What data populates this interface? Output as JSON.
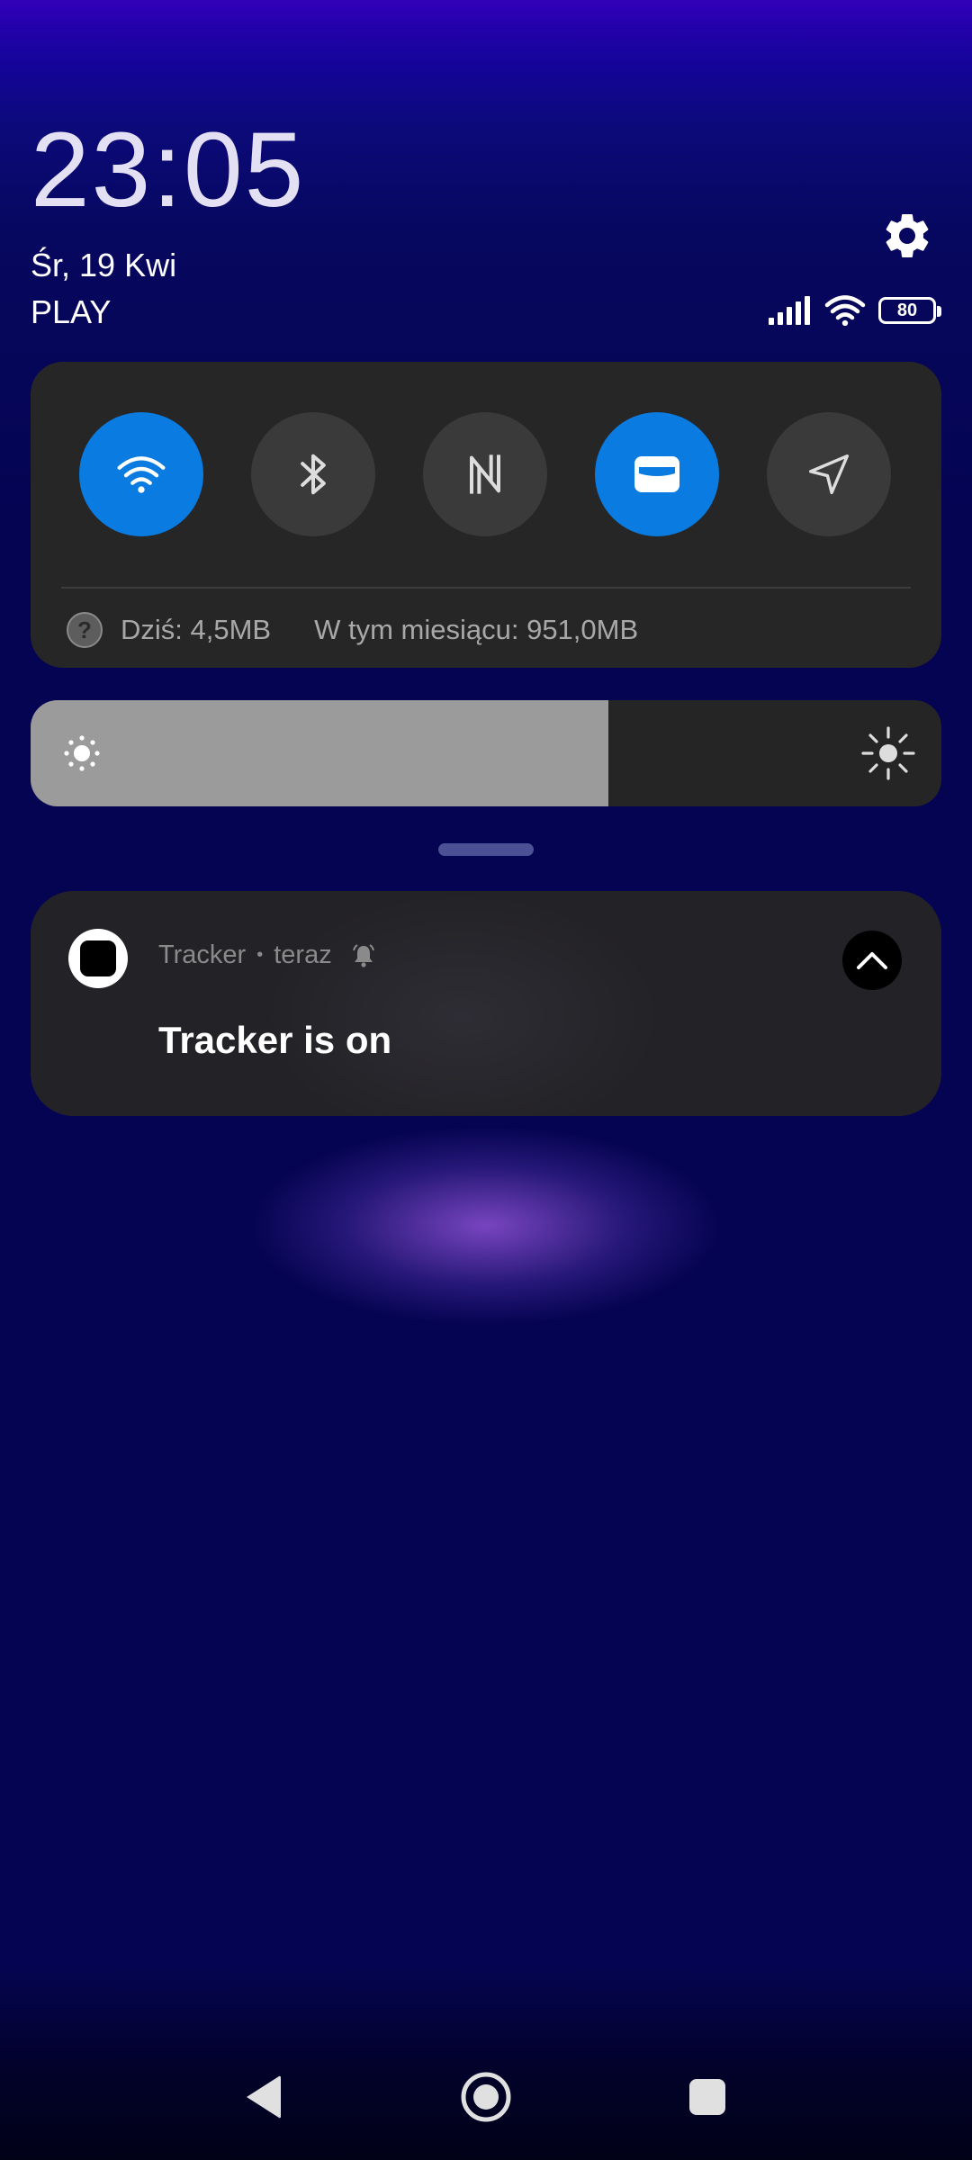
{
  "lockscreen": {
    "time": "23:05",
    "date": "Śr, 19 Kwi",
    "carrier": "PLAY",
    "battery": "80"
  },
  "quick_settings": {
    "tiles": [
      {
        "name": "wifi",
        "on": true
      },
      {
        "name": "bluetooth",
        "on": false
      },
      {
        "name": "nfc",
        "on": false
      },
      {
        "name": "card",
        "on": true
      },
      {
        "name": "location",
        "on": false
      }
    ],
    "usage_today": "Dziś: 4,5MB",
    "usage_month": "W tym miesiącu: 951,0MB"
  },
  "brightness": {
    "level_fraction": 0.634
  },
  "notification": {
    "app_name": "Tracker",
    "time": "teraz",
    "text": "Tracker is on"
  },
  "colors": {
    "accent": "#0a7be0",
    "panel": "#262626",
    "background": "#050452"
  }
}
